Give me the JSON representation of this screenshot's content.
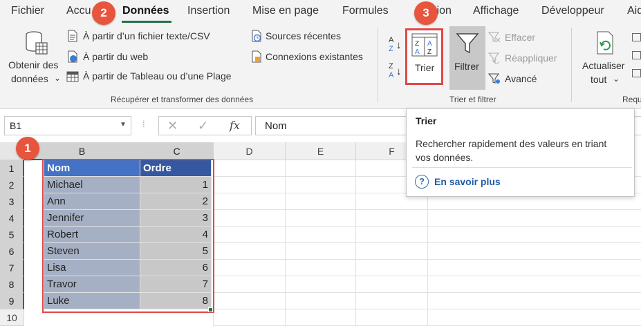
{
  "tabs": [
    "Fichier",
    "Accueil",
    "Données",
    "Insertion",
    "Mise en page",
    "Formules",
    "Révision",
    "Affichage",
    "Développeur",
    "Aide"
  ],
  "tabs_visible": {
    "t0": "Fichier",
    "t1": "Accu",
    "t2": "Données",
    "t3": "Insertion",
    "t4": "Mise en page",
    "t5": "Formules",
    "t6": "ision",
    "t7": "Affichage",
    "t8": "Développeur",
    "t9": "Aid"
  },
  "ribbon": {
    "get_data": {
      "line1": "Obtenir des",
      "line2": "données",
      "chev": "⌄"
    },
    "from_csv": "À partir d’un fichier texte/CSV",
    "from_web": "À partir du web",
    "from_table": "À partir de Tableau ou d’une Plage",
    "recent_sources": "Sources récentes",
    "existing_connections": "Connexions existantes",
    "group_get": "Récupérer et transformer des données",
    "sort": "Trier",
    "filter": "Filtrer",
    "clear": "Effacer",
    "reapply": "Réappliquer",
    "advanced": "Avancé",
    "group_sort": "Trier et filtrer",
    "refresh": {
      "line1": "Actualiser",
      "line2": "tout",
      "chev": "⌄"
    },
    "group_req": "Requ",
    "az_a": "A",
    "az_z": "Z",
    "za_z": "Z",
    "za_a": "A"
  },
  "formula_bar": {
    "name_box": "B1",
    "fx": "fx",
    "value": "Nom"
  },
  "tooltip": {
    "title": "Trier",
    "body": "Rechercher rapidement des valeurs en triant vos données.",
    "link": "En savoir plus"
  },
  "columns": [
    "B",
    "C",
    "D",
    "E",
    "F"
  ],
  "rows": [
    "1",
    "2",
    "3",
    "4",
    "5",
    "6",
    "7",
    "8",
    "9",
    "10"
  ],
  "table": {
    "headers": [
      "Nom",
      "Ordre"
    ],
    "data": [
      [
        "Michael",
        "1"
      ],
      [
        "Ann",
        "2"
      ],
      [
        "Jennifer",
        "3"
      ],
      [
        "Robert",
        "4"
      ],
      [
        "Steven",
        "5"
      ],
      [
        "Lisa",
        "6"
      ],
      [
        "Travor",
        "7"
      ],
      [
        "Luke",
        "8"
      ]
    ]
  },
  "badges": [
    "1",
    "2",
    "3"
  ],
  "colors": {
    "accent": "#217346",
    "badge": "#e8553e",
    "highlight": "#e04848",
    "header_blue": "#4472c4",
    "row_band": "#a6b0c4",
    "col_c_band": "#c8c8c8"
  }
}
